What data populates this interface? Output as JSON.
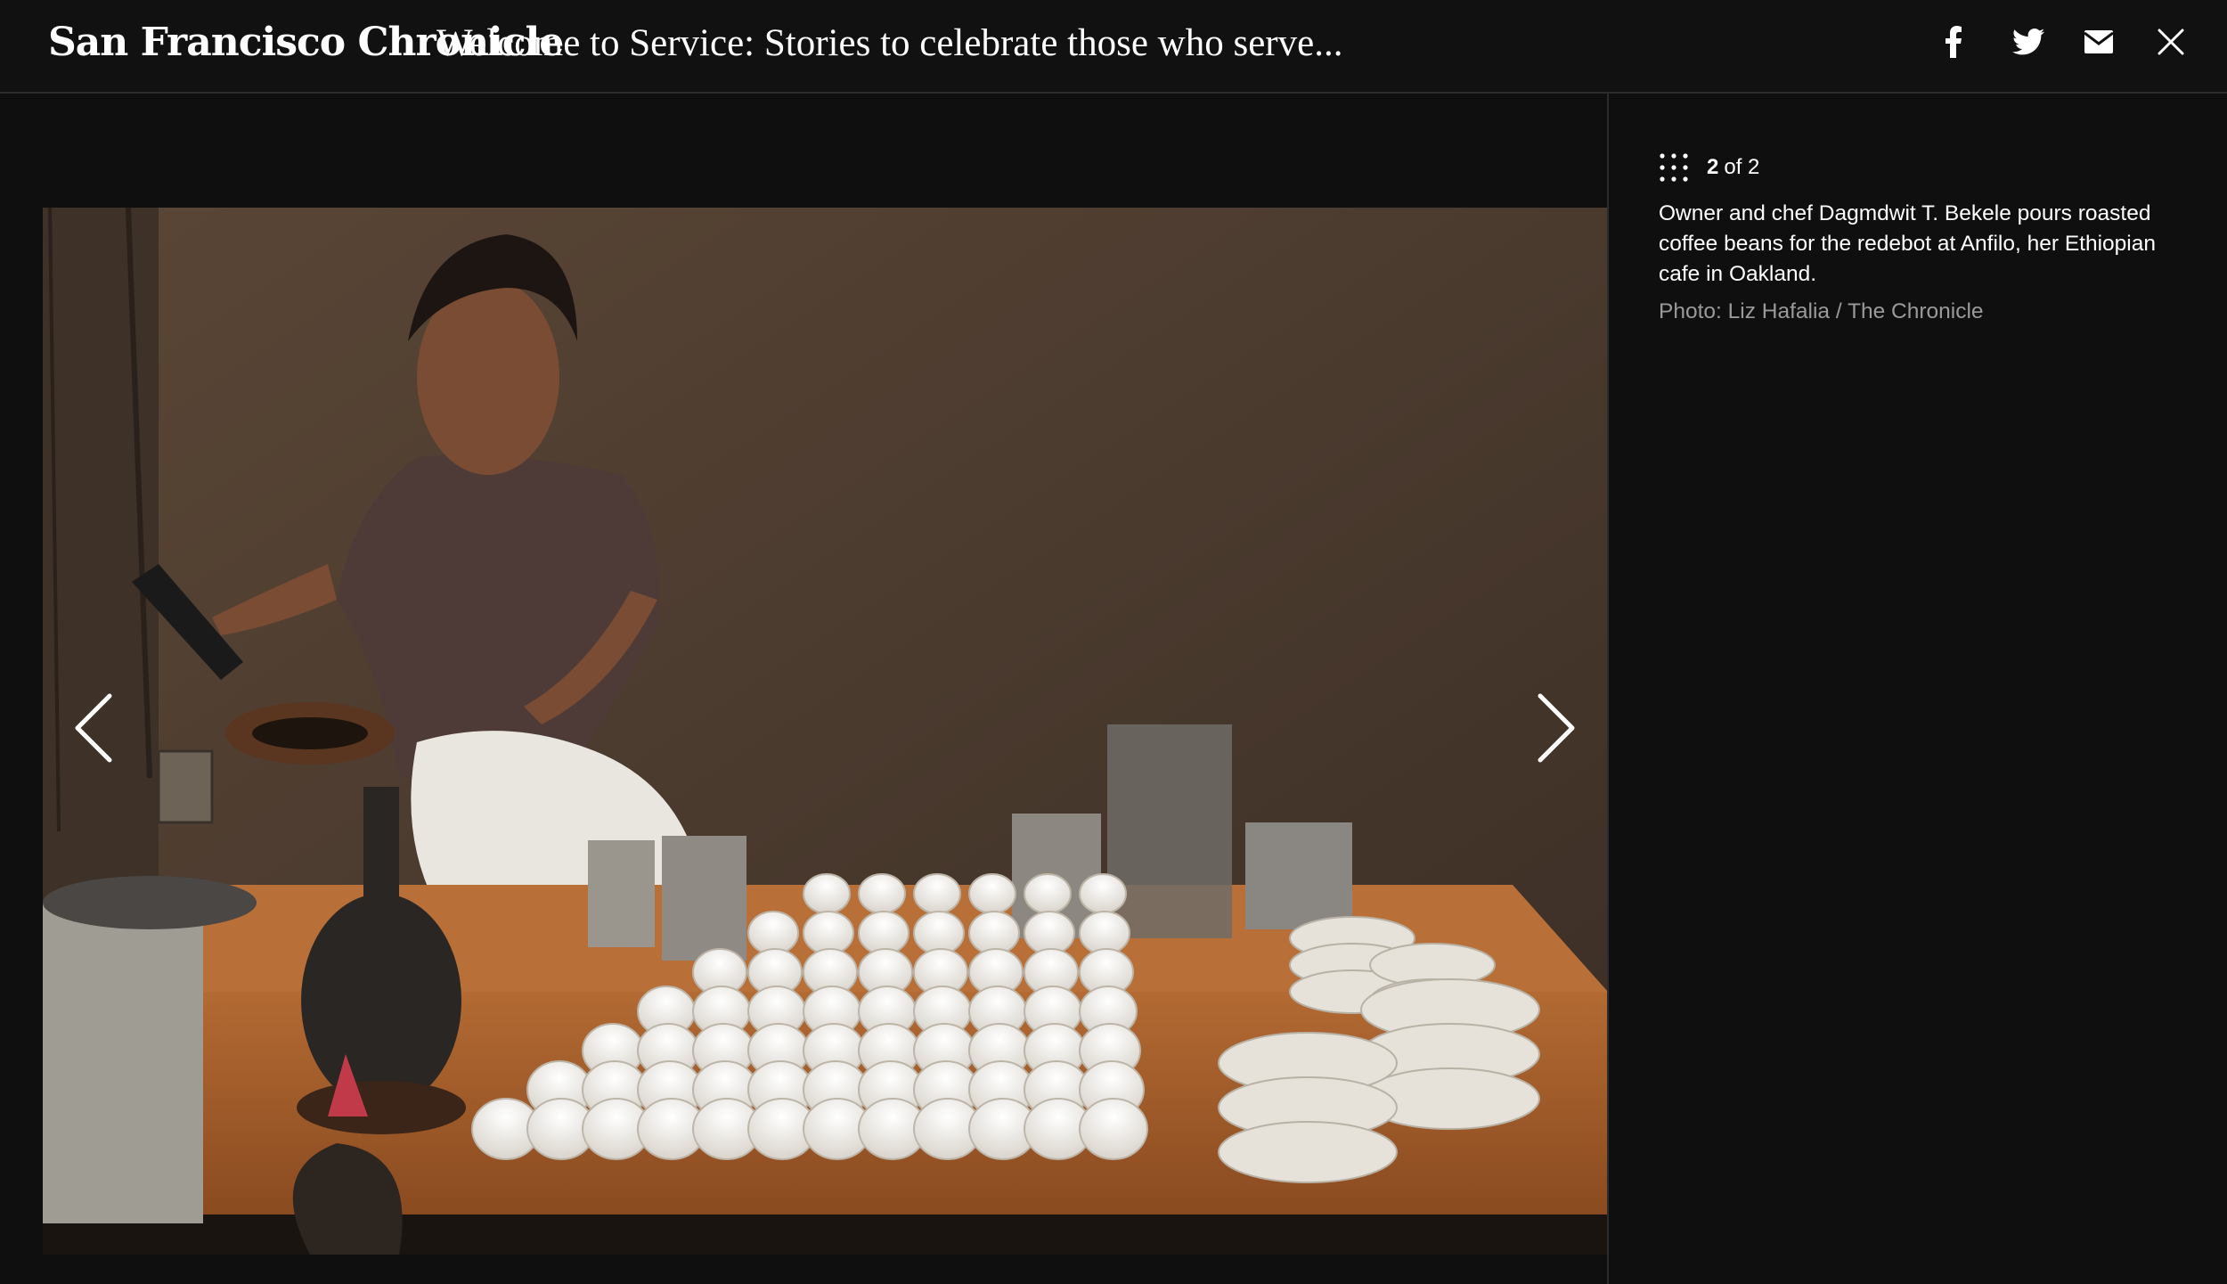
{
  "header": {
    "brand": "San Francisco Chronicle",
    "title": "Welcome to Service: Stories to celebrate those who serve...",
    "share_icons": [
      "facebook-icon",
      "twitter-icon",
      "email-icon"
    ],
    "close_icon": "close-icon"
  },
  "gallery": {
    "current": "2",
    "of_total": "of 2",
    "prev_icon": "chevron-left-icon",
    "next_icon": "chevron-right-icon",
    "grid_icon": "grid-icon"
  },
  "caption": {
    "text": "Owner and chef Dagmdwit T. Bekele pours roasted coffee beans for the redebot at Anfilo, her Ethiopian cafe in Oakland.",
    "credit": "Photo: Liz Hafalia / The Chronicle"
  },
  "colors": {
    "background": "#0f0f0f",
    "header": "#111111",
    "divider": "#2c2c2c",
    "credit_text": "#9a9a9a"
  }
}
